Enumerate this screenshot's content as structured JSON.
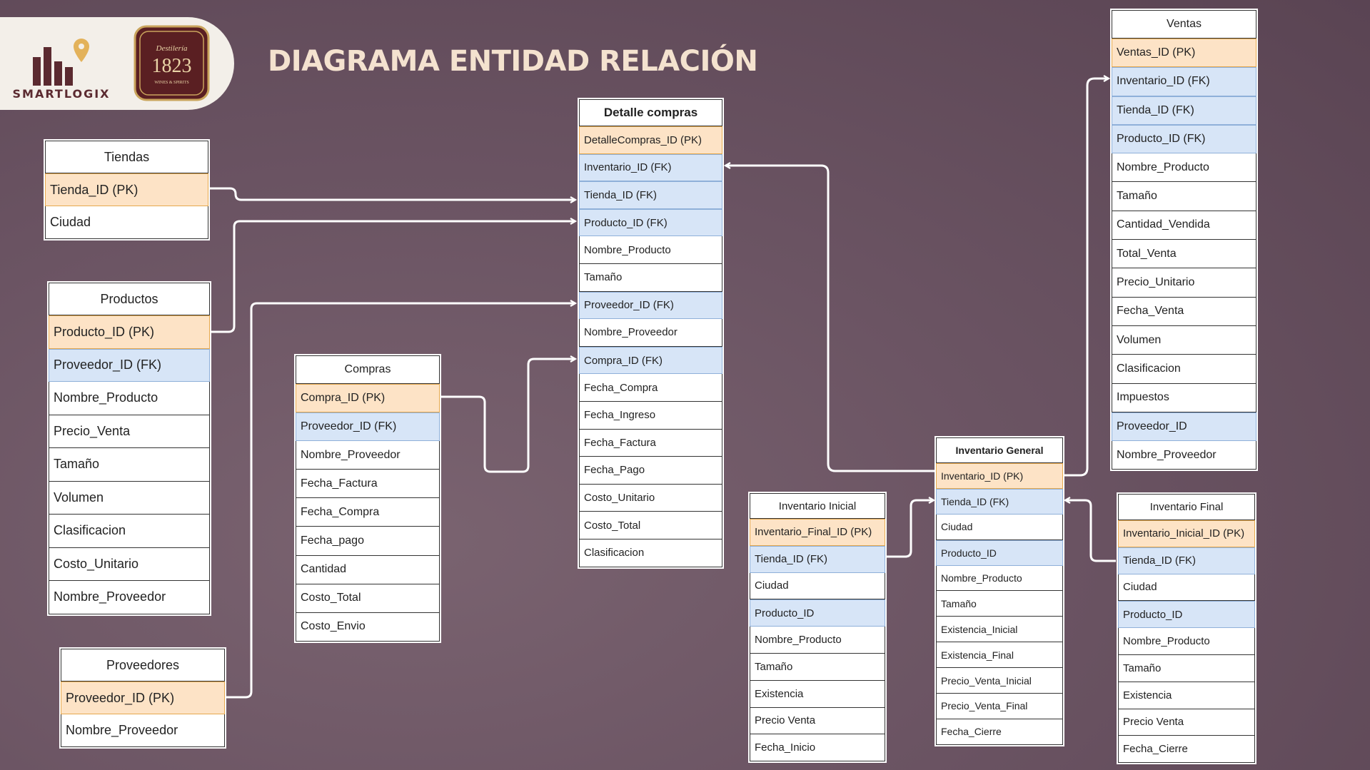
{
  "header": {
    "title": "DIAGRAMA ENTIDAD RELACIÓN",
    "brand": "SMARTLOGIX",
    "badge_top": "Destilería",
    "badge_year": "1823",
    "badge_bottom": "WINES & SPIRITS"
  },
  "colors": {
    "primary_key": "#fde3c6",
    "foreign_key": "#d7e5f7",
    "title": "#f4e2cf",
    "background": "#6b5463"
  },
  "entities": [
    {
      "id": "tiendas",
      "title": "Tiendas",
      "fields": [
        {
          "name": "Tienda_ID (PK)",
          "key": "pk"
        },
        {
          "name": "Ciudad",
          "key": ""
        }
      ]
    },
    {
      "id": "productos",
      "title": "Productos",
      "fields": [
        {
          "name": "Producto_ID (PK)",
          "key": "pk"
        },
        {
          "name": " Proveedor_ID (FK)",
          "key": "fk"
        },
        {
          "name": "Nombre_Producto",
          "key": ""
        },
        {
          "name": "Precio_Venta",
          "key": ""
        },
        {
          "name": "Tamaño",
          "key": ""
        },
        {
          "name": "Volumen",
          "key": ""
        },
        {
          "name": "Clasificacion",
          "key": ""
        },
        {
          "name": "Costo_Unitario",
          "key": ""
        },
        {
          "name": "Nombre_Proveedor",
          "key": ""
        }
      ]
    },
    {
      "id": "proveedores",
      "title": "Proveedores",
      "fields": [
        {
          "name": "Proveedor_ID (PK)",
          "key": "pk"
        },
        {
          "name": "Nombre_Proveedor",
          "key": ""
        }
      ]
    },
    {
      "id": "compras",
      "title": "Compras",
      "fields": [
        {
          "name": "Compra_ID  (PK)",
          "key": "pk"
        },
        {
          "name": " Proveedor_ID (FK)",
          "key": "fk"
        },
        {
          "name": "Nombre_Proveedor",
          "key": ""
        },
        {
          "name": "Fecha_Factura",
          "key": ""
        },
        {
          "name": "Fecha_Compra",
          "key": ""
        },
        {
          "name": "Fecha_pago",
          "key": ""
        },
        {
          "name": "Cantidad",
          "key": ""
        },
        {
          "name": "Costo_Total",
          "key": ""
        },
        {
          "name": "Costo_Envio",
          "key": ""
        }
      ]
    },
    {
      "id": "detalle",
      "title": "Detalle compras",
      "fields": [
        {
          "name": "DetalleCompras_ID  (PK)",
          "key": "pk"
        },
        {
          "name": "Inventario_ID (FK)",
          "key": "fk"
        },
        {
          "name": "Tienda_ID (FK)",
          "key": "fk"
        },
        {
          "name": "Producto_ID (FK)",
          "key": "fk"
        },
        {
          "name": "Nombre_Producto",
          "key": ""
        },
        {
          "name": "Tamaño",
          "key": ""
        },
        {
          "name": " Proveedor_ID (FK)",
          "key": "fk"
        },
        {
          "name": "Nombre_Proveedor",
          "key": ""
        },
        {
          "name": "Compra_ID (FK)",
          "key": "fk"
        },
        {
          "name": "Fecha_Compra",
          "key": ""
        },
        {
          "name": "Fecha_Ingreso",
          "key": ""
        },
        {
          "name": "Fecha_Factura",
          "key": ""
        },
        {
          "name": "Fecha_Pago",
          "key": ""
        },
        {
          "name": "Costo_Unitario",
          "key": ""
        },
        {
          "name": "Costo_Total",
          "key": ""
        },
        {
          "name": "Clasificacion",
          "key": ""
        }
      ]
    },
    {
      "id": "inv_inicial",
      "title": "Inventario Inicial",
      "fields": [
        {
          "name": "Inventario_Final_ID  (PK)",
          "key": "pk"
        },
        {
          "name": "Tienda_ID (FK)",
          "key": "fk"
        },
        {
          "name": "Ciudad",
          "key": ""
        },
        {
          "name": "Producto_ID",
          "key": "fk"
        },
        {
          "name": "Nombre_Producto",
          "key": ""
        },
        {
          "name": "Tamaño",
          "key": ""
        },
        {
          "name": "Existencia",
          "key": ""
        },
        {
          "name": "Precio Venta",
          "key": ""
        },
        {
          "name": "Fecha_Inicio",
          "key": ""
        }
      ]
    },
    {
      "id": "inv_general",
      "title": "Inventario General",
      "fields": [
        {
          "name": "Inventario_ID  (PK)",
          "key": "pk"
        },
        {
          "name": "Tienda_ID (FK)",
          "key": "fk"
        },
        {
          "name": "Ciudad",
          "key": ""
        },
        {
          "name": "Producto_ID",
          "key": "fk"
        },
        {
          "name": "Nombre_Producto",
          "key": ""
        },
        {
          "name": "Tamaño",
          "key": ""
        },
        {
          "name": "Existencia_Inicial",
          "key": ""
        },
        {
          "name": "Existencia_Final",
          "key": ""
        },
        {
          "name": "Precio_Venta_Inicial",
          "key": ""
        },
        {
          "name": "Precio_Venta_Final",
          "key": ""
        },
        {
          "name": "Fecha_Cierre",
          "key": ""
        }
      ]
    },
    {
      "id": "inv_final",
      "title": "Inventario Final",
      "fields": [
        {
          "name": "Inventario_Inicial_ID  (PK)",
          "key": "pk"
        },
        {
          "name": "Tienda_ID (FK)",
          "key": "fk"
        },
        {
          "name": "Ciudad",
          "key": ""
        },
        {
          "name": "Producto_ID",
          "key": "fk"
        },
        {
          "name": "Nombre_Producto",
          "key": ""
        },
        {
          "name": "Tamaño",
          "key": ""
        },
        {
          "name": "Existencia",
          "key": ""
        },
        {
          "name": "Precio Venta",
          "key": ""
        },
        {
          "name": "Fecha_Cierre",
          "key": ""
        }
      ]
    },
    {
      "id": "ventas",
      "title": "Ventas",
      "fields": [
        {
          "name": "Ventas_ID (PK)",
          "key": "pk"
        },
        {
          "name": "Inventario_ID (FK)",
          "key": "fk"
        },
        {
          "name": "Tienda_ID (FK)",
          "key": "fk"
        },
        {
          "name": "Producto_ID (FK)",
          "key": "fk"
        },
        {
          "name": "Nombre_Producto",
          "key": ""
        },
        {
          "name": "Tamaño",
          "key": ""
        },
        {
          "name": "Cantidad_Vendida",
          "key": ""
        },
        {
          "name": "Total_Venta",
          "key": ""
        },
        {
          "name": "Precio_Unitario",
          "key": ""
        },
        {
          "name": "Fecha_Venta",
          "key": ""
        },
        {
          "name": "Volumen",
          "key": ""
        },
        {
          "name": "Clasificacion",
          "key": ""
        },
        {
          "name": "Impuestos",
          "key": ""
        },
        {
          "name": "Proveedor_ID",
          "key": "fk"
        },
        {
          "name": "Nombre_Proveedor",
          "key": ""
        }
      ]
    }
  ],
  "relationships": [
    {
      "from": "tiendas.Tienda_ID",
      "to": "detalle.Tienda_ID"
    },
    {
      "from": "productos.Producto_ID",
      "to": "detalle.Producto_ID"
    },
    {
      "from": "proveedores.Proveedor_ID",
      "to": "detalle.Proveedor_ID"
    },
    {
      "from": "compras.Compra_ID",
      "to": "detalle.Compra_ID"
    },
    {
      "from": "inv_general.Inventario_ID",
      "to": "detalle.Inventario_ID"
    },
    {
      "from": "inv_general.Inventario_ID",
      "to": "ventas.Inventario_ID"
    },
    {
      "from": "inv_inicial.Tienda_ID",
      "to": "inv_general.Tienda_ID"
    },
    {
      "from": "inv_final.Tienda_ID",
      "to": "inv_general.Tienda_ID"
    }
  ]
}
